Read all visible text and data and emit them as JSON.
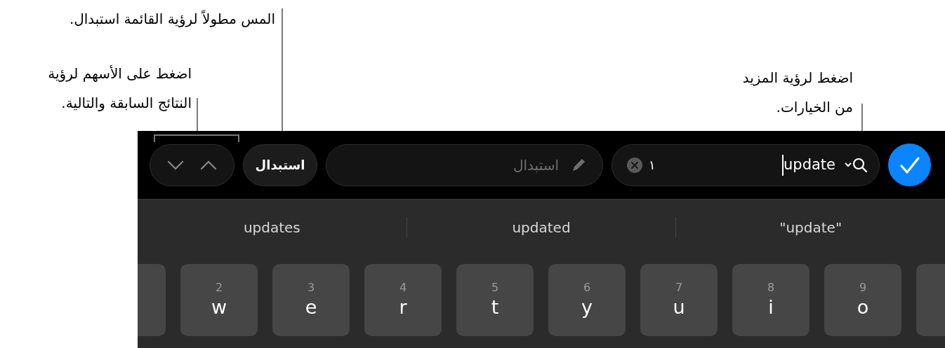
{
  "callouts": [
    {
      "bracket": false,
      "text": "المس مطولاً لرؤية القائمة استبدال."
    },
    {
      "bracket": false,
      "text": "اضغط لرؤية المزيد\nمن الخيارات."
    },
    {
      "bracket": true,
      "text": "اضغط على الأسهم لرؤية\nالنتائج السابقة والتالية."
    }
  ],
  "toolbar": {
    "replace_button": "استبدال",
    "replace_field": {
      "placeholder": "استبدال"
    },
    "search_field": {
      "value": "update",
      "match_count": "١"
    }
  },
  "suggestions": [
    "\"update\"",
    "updated",
    "updates"
  ],
  "keys": [
    {
      "digit": "9",
      "letter": "o"
    },
    {
      "digit": "8",
      "letter": "i"
    },
    {
      "digit": "7",
      "letter": "u"
    },
    {
      "digit": "6",
      "letter": "y"
    },
    {
      "digit": "5",
      "letter": "t"
    },
    {
      "digit": "4",
      "letter": "r"
    },
    {
      "digit": "3",
      "letter": "e"
    },
    {
      "digit": "2",
      "letter": "w"
    }
  ]
}
